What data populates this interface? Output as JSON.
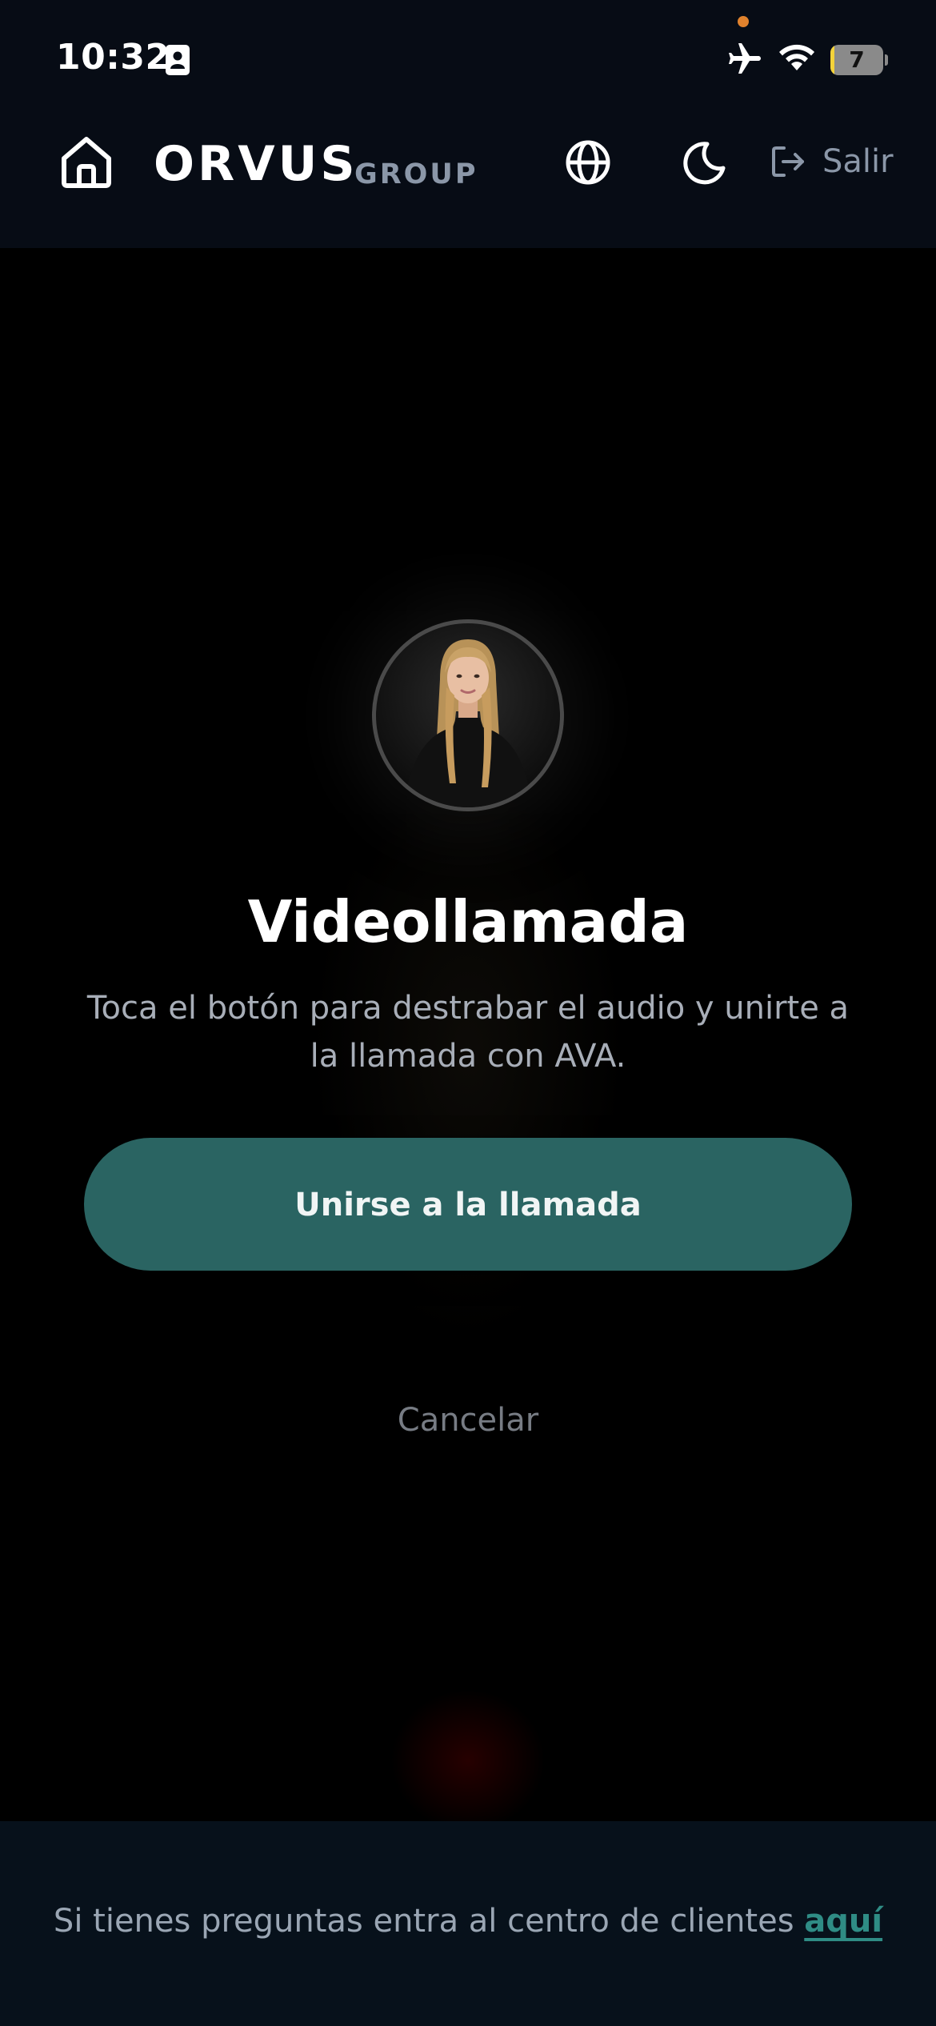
{
  "status_bar": {
    "time": "10:32",
    "battery_level": "7",
    "battery_fraction": 0.07,
    "icons": [
      "contact-card-icon",
      "airplane-icon",
      "wifi-icon",
      "battery-icon"
    ]
  },
  "header": {
    "brand_name": "ORVUS",
    "brand_suffix": "GROUP",
    "logout_label": "Salir",
    "icons": [
      "home-icon",
      "globe-icon",
      "moon-icon",
      "logout-icon"
    ]
  },
  "call": {
    "title": "Videollamada",
    "description": "Toca el botón para destrabar el audio y unirte a la llamada con AVA.",
    "join_label": "Unirse a la llamada",
    "cancel_label": "Cancelar"
  },
  "footer": {
    "text": "Si tienes preguntas entra al centro de clientes",
    "link_label": "aquí"
  },
  "colors": {
    "accent": "#2a6462",
    "link": "#2f8c85",
    "header_bg": "#070c15",
    "recording_dot": "#e0822d",
    "battery_fill": "#f4d33a"
  }
}
